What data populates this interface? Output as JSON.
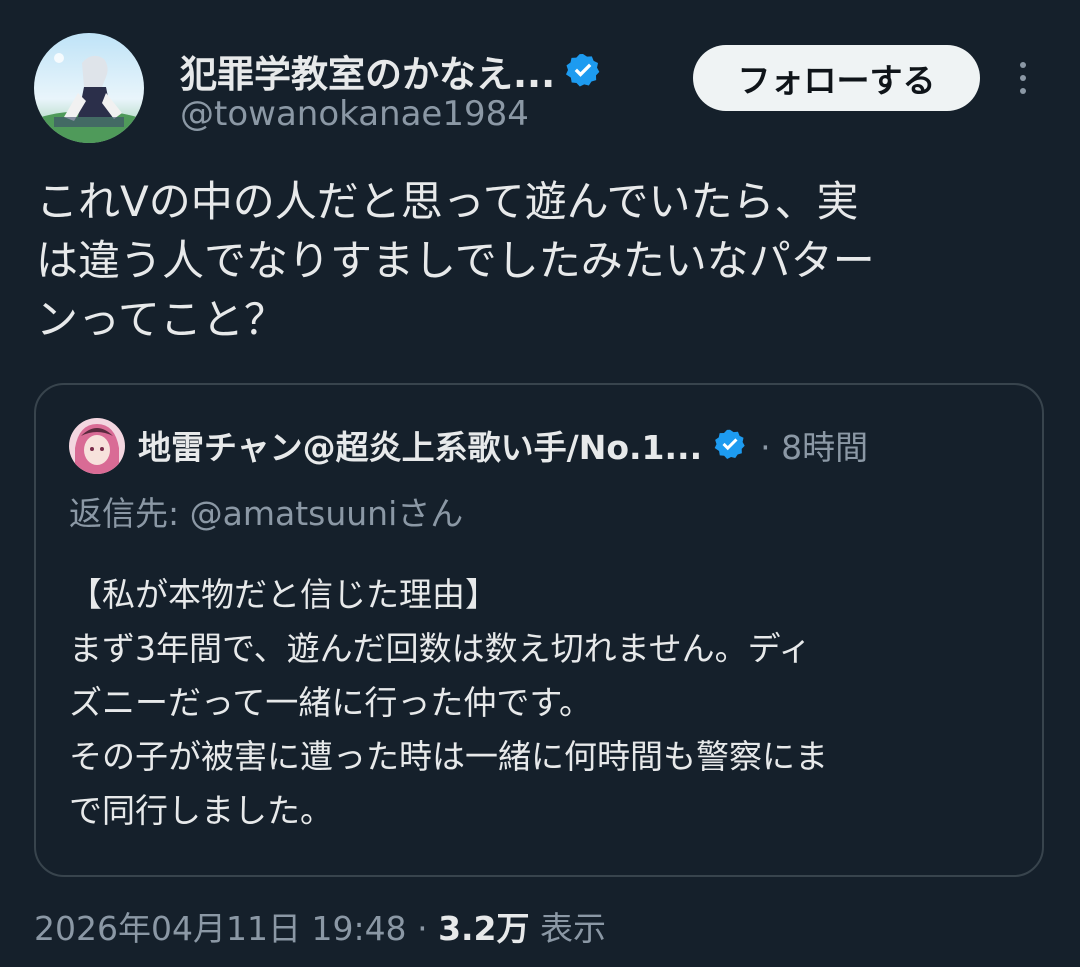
{
  "author": {
    "name": "犯罪学教室のかなえ...",
    "handle": "@towanokanae1984",
    "verified": true
  },
  "follow_button": {
    "label": "フォローする"
  },
  "more_icon": "more-vertical-icon",
  "tweet": {
    "text": "これVの中の人だと思って遊んでいたら、実\nは違う人でなりすましでしたみたいなパター\nンってこと？"
  },
  "quote": {
    "author_name": "地雷チャン@超炎上系歌い手/No.1...",
    "verified": true,
    "time": "· 8時間",
    "reply_to": "返信先: @amatsuuniさん",
    "body": "【私が本物だと信じた理由】\nまず3年間で、遊んだ回数は数え切れません。ディ\nズニーだって一緒に行った仲です。\nその子が被害に遭った時は一緒に何時間も警察にま\nで同行しました。"
  },
  "meta": {
    "datetime": "2026年04月11日 19:48",
    "separator": "·",
    "views_count": "3.2万",
    "views_label": "表示"
  },
  "colors": {
    "background": "#15202b",
    "text": "#e7e9ea",
    "secondary": "#8b98a5",
    "border": "#38444d",
    "verified_blue": "#1d9bf0",
    "button_bg": "#eff3f4"
  }
}
